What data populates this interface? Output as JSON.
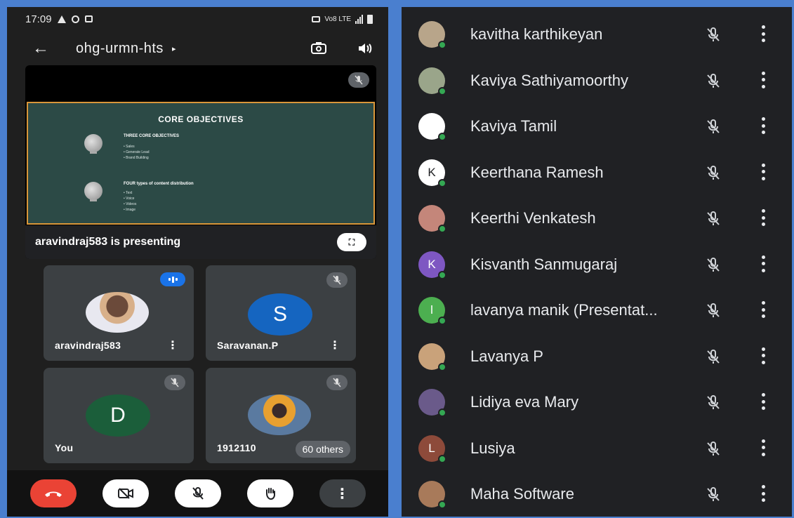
{
  "status_bar": {
    "time": "17:09",
    "network": "Vo8 LTE"
  },
  "meeting": {
    "code": "ohg-urmn-hts"
  },
  "presentation": {
    "presenter_text": "aravindraj583 is presenting",
    "slide_title": "CORE OBJECTIVES",
    "section1_heading": "THREE CORE OBJECTIVES",
    "section1_items": [
      "Sales",
      "Generate Lead",
      "Brand Building"
    ],
    "section2_heading": "FOUR types of content distribution",
    "section2_items": [
      "Text",
      "Voice",
      "Videos",
      "Image"
    ]
  },
  "tiles": [
    {
      "name": "aravindraj583",
      "state": "speaking"
    },
    {
      "name": "Saravanan.P",
      "initial": "S",
      "color": "#1565c0",
      "state": "muted"
    },
    {
      "name": "You",
      "initial": "D",
      "color": "#1b5e3a",
      "state": "muted"
    },
    {
      "name": "1912110",
      "others": "60 others",
      "state": "muted"
    }
  ],
  "participants": [
    {
      "name": "kavitha karthikeyan",
      "avatar_color": "#b8a58a",
      "initial": ""
    },
    {
      "name": "Kaviya Sathiyamoorthy",
      "avatar_color": "#9aa58a",
      "initial": ""
    },
    {
      "name": "Kaviya Tamil",
      "avatar_color": "#ffffff",
      "initial": ""
    },
    {
      "name": "Keerthana Ramesh",
      "avatar_color": "#ffffff",
      "initial": "K"
    },
    {
      "name": "Keerthi Venkatesh",
      "avatar_color": "#c4867a",
      "initial": ""
    },
    {
      "name": "Kisvanth Sanmugaraj",
      "avatar_color": "#7e57c2",
      "initial": "K"
    },
    {
      "name": "lavanya manik (Presentat...",
      "avatar_color": "#4caf50",
      "initial": "l"
    },
    {
      "name": "Lavanya P",
      "avatar_color": "#c9a27a",
      "initial": ""
    },
    {
      "name": "Lidiya eva Mary",
      "avatar_color": "#6a5a8a",
      "initial": ""
    },
    {
      "name": "Lusiya",
      "avatar_color": "#8d4a3a",
      "initial": "L"
    },
    {
      "name": "Maha Software",
      "avatar_color": "#a87a5a",
      "initial": ""
    }
  ]
}
